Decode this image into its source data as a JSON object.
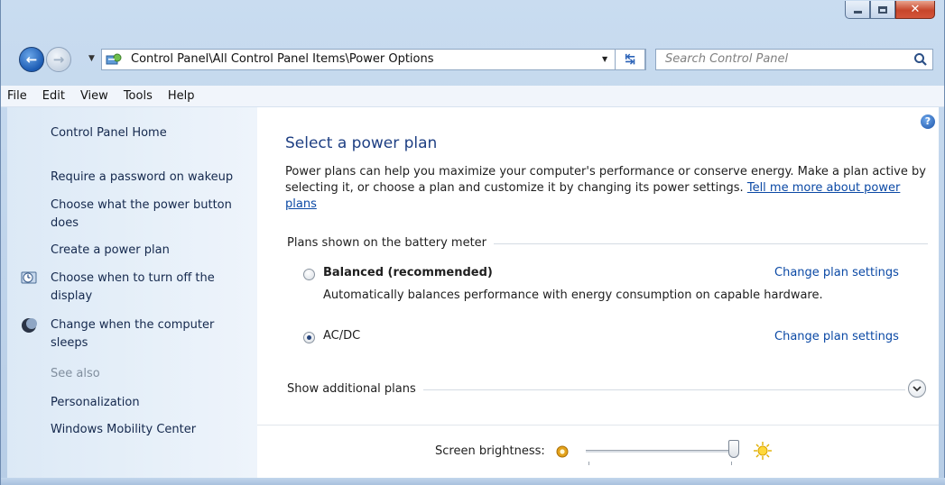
{
  "window": {
    "minimize_icon": "minimize-icon",
    "maximize_icon": "maximize-icon",
    "close_icon": "close-icon"
  },
  "nav": {
    "address": "Control Panel\\All Control Panel Items\\Power Options",
    "search_placeholder": "Search Control Panel"
  },
  "menu": [
    "File",
    "Edit",
    "View",
    "Tools",
    "Help"
  ],
  "sidebar": {
    "home": "Control Panel Home",
    "items": [
      "Require a password on wakeup",
      "Choose what the power button does",
      "Create a power plan",
      "Choose when to turn off the display",
      "Change when the computer sleeps"
    ],
    "see_also": "See also",
    "see_also_items": [
      "Personalization",
      "Windows Mobility Center"
    ]
  },
  "content": {
    "title": "Select a power plan",
    "description": "Power plans can help you maximize your computer's performance or conserve energy. Make a plan active by selecting it, or choose a plan and customize it by changing its power settings.",
    "learn_link": "Tell me more about power plans",
    "group_label": "Plans shown on the battery meter",
    "plans": [
      {
        "name": "Balanced (recommended)",
        "description": "Automatically balances performance with energy consumption on capable hardware.",
        "link": "Change plan settings",
        "selected": false
      },
      {
        "name": "AC/DC",
        "description": "",
        "link": "Change plan settings",
        "selected": true
      }
    ],
    "show_additional": "Show additional plans",
    "brightness_label": "Screen brightness:",
    "brightness_level": 1.0
  },
  "colors": {
    "title_blue": "#1e3f83",
    "link_blue": "#0b49a5",
    "sidebar_bg": "#e3eef9"
  }
}
